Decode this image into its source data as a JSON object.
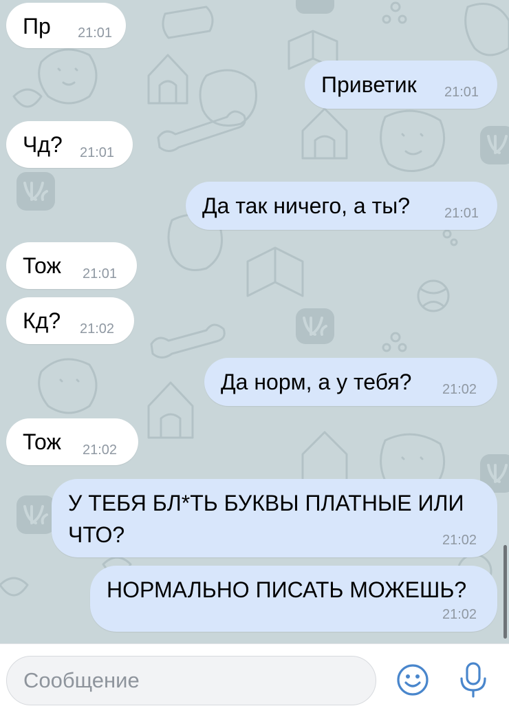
{
  "messages": [
    {
      "direction": "in",
      "text": "Пр",
      "time": "21:01"
    },
    {
      "direction": "out",
      "text": "Приветик",
      "time": "21:01"
    },
    {
      "direction": "in",
      "text": "Чд?",
      "time": "21:01"
    },
    {
      "direction": "out",
      "text": "Да так ничего, а ты?",
      "time": "21:01"
    },
    {
      "direction": "in",
      "text": "Тож",
      "time": "21:01"
    },
    {
      "direction": "in",
      "text": "Кд?",
      "time": "21:02"
    },
    {
      "direction": "out",
      "text": "Да норм, а у тебя?",
      "time": "21:02"
    },
    {
      "direction": "in",
      "text": "Тож",
      "time": "21:02"
    },
    {
      "direction": "out",
      "text": "У ТЕБЯ БЛ*ТЬ БУКВЫ ПЛАТНЫЕ ИЛИ ЧТО?",
      "time": "21:02"
    },
    {
      "direction": "out",
      "text": "НОРМАЛЬНО ПИСАТЬ МОЖЕШЬ?",
      "time": "21:02"
    }
  ],
  "composer": {
    "placeholder": "Сообщение",
    "value": "",
    "emoji_icon": "emoji-icon",
    "mic_icon": "microphone-icon"
  },
  "colors": {
    "wallpaper": "#c9d6d9",
    "incoming_bubble": "#ffffff",
    "outgoing_bubble": "#d8e6fb",
    "time_text": "#8f98a2",
    "accent": "#4986cc"
  }
}
